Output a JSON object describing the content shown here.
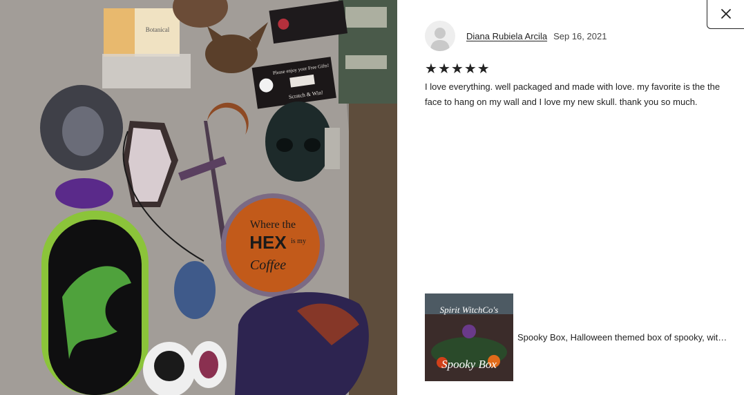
{
  "review": {
    "reviewer_name": "Diana Rubiela Arcila",
    "date": "Sep 16, 2021",
    "rating": 5,
    "stars": [
      "★",
      "★",
      "★",
      "★",
      "★"
    ],
    "text": "I love everything. well packaged and made with love. my favorite is the the face to hang on my wall and I love my new skull. thank you so much."
  },
  "photo": {
    "alt": "Customer photo of resin items",
    "card_text_1": "Please enjoy your Free Gifts!",
    "card_text_2": "Scratch & Win!",
    "coaster_line_1": "Where the",
    "coaster_line_2": "HEX",
    "coaster_line_3": "is my",
    "coaster_line_4": "Coffee",
    "label_text": "Botanical"
  },
  "item": {
    "title": "Spooky Box, Halloween themed box of spooky, wit…",
    "thumb_text_1": "Spirit WitchCo's",
    "thumb_text_2": "Spooky Box"
  },
  "icons": {
    "close": "close-icon",
    "avatar": "avatar-placeholder-icon",
    "star": "star-icon"
  },
  "colors": {
    "text": "#222222",
    "avatar_bg": "#eeeeee"
  }
}
